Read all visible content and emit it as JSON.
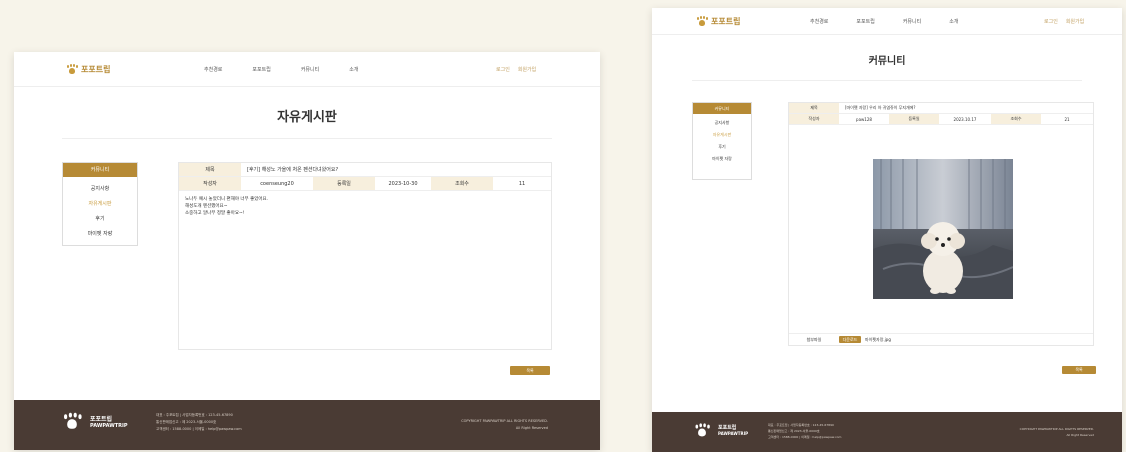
{
  "brand": {
    "name": "포포트립",
    "name_en": "PAWPAWTRIP"
  },
  "nav": [
    "추천경로",
    "포포트립",
    "커뮤니티",
    "소개"
  ],
  "auth": {
    "login": "로그인",
    "signup": "회원가입"
  },
  "left_page": {
    "title": "자유게시판",
    "sidebar": {
      "header": "커뮤니티",
      "items": [
        "공지사항",
        "자유게시판",
        "후기",
        "마이펫 자랑"
      ],
      "active_index": 1
    },
    "post": {
      "subject_label": "제목",
      "subject": "[후기] 해성노 가을에 처온 펜션다녀왔어요?",
      "author_label": "작성자",
      "author": "coenseung20",
      "date_label": "등록일",
      "date": "2023-10-30",
      "views_label": "조회수",
      "views": "11",
      "body": [
        "노나두 예시 놓았더니 편해야 너무 좋았어요.",
        "해성도개 펜션했어요~",
        "소중하고 알나무 정말 좋아요~!"
      ]
    },
    "button": "목록"
  },
  "right_page": {
    "title": "커뮤니티",
    "sidebar": {
      "header": "커뮤니티",
      "items": [
        "공지사항",
        "자유게시판",
        "후기",
        "마이펫 자랑"
      ],
      "active_index": 1
    },
    "post": {
      "subject_label": "제목",
      "subject": "[마이펫 자랑] 우리 아 귀엽쥬이 무지개에?",
      "author_label": "작성자",
      "author": "paw128",
      "date_label": "등록일",
      "date": "2023.10.17",
      "views_label": "조회수",
      "views": "21",
      "attach_label": "첨부파일",
      "attach_btn": "다운로드",
      "attach_file": "마이펫자랑.jpg"
    },
    "button": "목록"
  },
  "footer": {
    "info": [
      "대표 : 주포트립 | 사업자등록번호 : 123-45-67890",
      "통신판매업신고 : 제 2023-서울-0000호",
      "고객센터 : 1588-0000 | 이메일 : help@pawpaw.com"
    ],
    "copy": [
      "COPYRIGHT PAWPAWTRIP ALL RIGHTS RESERVED.",
      "All Right Reserved"
    ]
  }
}
